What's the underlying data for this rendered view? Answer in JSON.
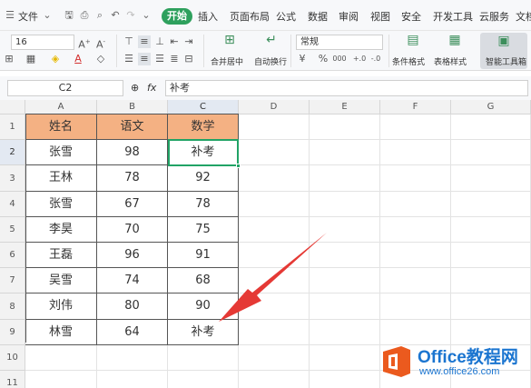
{
  "menubar": {
    "file_label": "文件",
    "start_label": "开始",
    "tabs": [
      "插入",
      "页面布局",
      "公式",
      "数据",
      "审阅",
      "视图",
      "安全",
      "开发工具",
      "云服务",
      "文档"
    ]
  },
  "ribbon": {
    "font_size": "16",
    "number_format": "常规",
    "merge_label": "合并居中",
    "wrap_label": "自动换行",
    "percent_symbol": "%",
    "thousands_symbol": "000",
    "decimal_inc": "+.0",
    "decimal_dec": "-.0",
    "cond_format_label": "条件格式",
    "table_style_label": "表格样式",
    "smart_toolbox_label": "智能工具箱"
  },
  "formula_bar": {
    "cell_ref": "C2",
    "fx_label": "fx",
    "content": "补考"
  },
  "sheet": {
    "columns": [
      "A",
      "B",
      "C",
      "D",
      "E",
      "F",
      "G"
    ],
    "rows": [
      "1",
      "2",
      "3",
      "4",
      "5",
      "6",
      "7",
      "8",
      "9",
      "10",
      "11"
    ],
    "header": [
      "姓名",
      "语文",
      "数学"
    ],
    "data": [
      [
        "张雪",
        "98",
        "补考"
      ],
      [
        "王林",
        "78",
        "92"
      ],
      [
        "张雪",
        "67",
        "78"
      ],
      [
        "李昊",
        "70",
        "75"
      ],
      [
        "王磊",
        "96",
        "91"
      ],
      [
        "吴雪",
        "74",
        "68"
      ],
      [
        "刘伟",
        "80",
        "90"
      ],
      [
        "林雪",
        "64",
        "补考"
      ]
    ]
  },
  "watermark": {
    "brand": "Office教程网",
    "url": "www.office26.com"
  },
  "colors": {
    "header_fill": "#f4b183",
    "active_border": "#21a366",
    "arrow": "#e53935",
    "brand_blue": "#1b75d0",
    "logo_orange": "#eb5a1e"
  }
}
